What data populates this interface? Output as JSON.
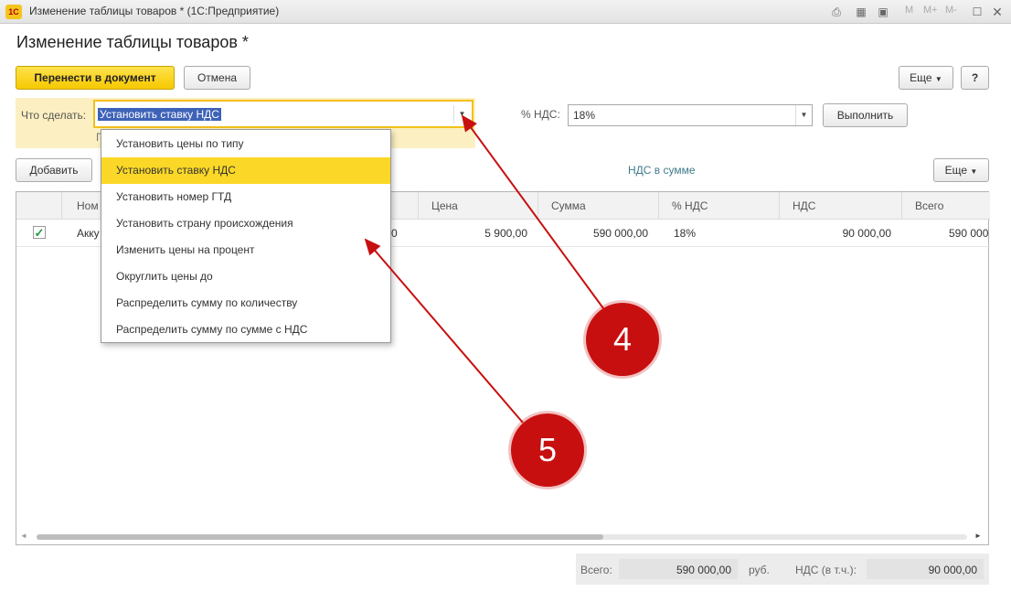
{
  "window": {
    "title": "Изменение таблицы товаров * (1С:Предприятие)",
    "app_icon": "1С"
  },
  "titlebar_buttons": {
    "m": "M",
    "m_plus": "M+",
    "m_minus": "M-"
  },
  "form": {
    "title": "Изменение таблицы товаров *"
  },
  "toolbar": {
    "transfer": "Перенести в документ",
    "cancel": "Отмена",
    "more": "Еще",
    "help": "?"
  },
  "action": {
    "label": "Что сделать:",
    "value": "Установить ставку НДС",
    "vat_label": "% НДС:",
    "vat_value": "18%",
    "execute": "Выполнить",
    "hint_fragment": "П"
  },
  "table_toolbar": {
    "add": "Добавить",
    "vat_in_sum": "НДС в сумме",
    "more": "Еще"
  },
  "table": {
    "headers": {
      "name": "Ном",
      "price": "Цена",
      "sum": "Сумма",
      "vat_rate": "% НДС",
      "vat": "НДС",
      "total": "Всего"
    },
    "row": {
      "name": "Акку",
      "qty_fragment": "0",
      "price": "5 900,00",
      "sum": "590 000,00",
      "vat_rate": "18%",
      "vat": "90 000,00",
      "total": "590 000"
    }
  },
  "dropdown": {
    "items": [
      "Установить цены по типу",
      "Установить ставку НДС",
      "Установить номер ГТД",
      "Установить страну происхождения",
      "Изменить цены на процент",
      "Округлить цены до",
      "Распределить сумму по количеству",
      "Распределить сумму по сумме с НДС"
    ],
    "selected_index": 1
  },
  "totals": {
    "total_label": "Всего:",
    "total_value": "590 000,00",
    "currency": "руб.",
    "vat_label": "НДС (в т.ч.):",
    "vat_value": "90 000,00"
  },
  "annotations": {
    "four": "4",
    "five": "5"
  },
  "colors": {
    "accent_yellow": "#f6c800",
    "highlight": "#fbd827",
    "annotation_red": "#c80f0f",
    "selection_blue": "#3d62b8"
  }
}
